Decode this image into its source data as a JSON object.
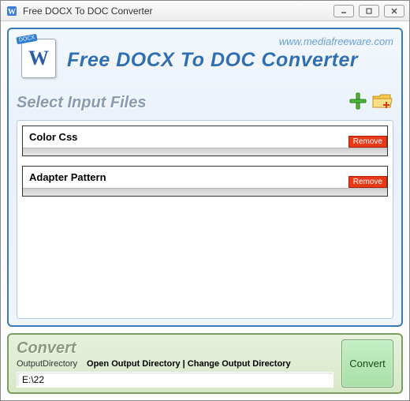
{
  "window": {
    "title": "Free DOCX To DOC Converter"
  },
  "header": {
    "url": "www.mediafreeware.com",
    "app_title": "Free DOCX To DOC Converter",
    "icon_badge": "DOCX",
    "icon_letter": "W"
  },
  "input_section": {
    "title": "Select Input Files",
    "files": [
      {
        "name": "Color Css",
        "remove_label": "Remove"
      },
      {
        "name": "Adapter Pattern",
        "remove_label": "Remove"
      }
    ]
  },
  "convert_section": {
    "title": "Convert",
    "output_label": "OutputDirectory",
    "open_link": "Open Output Directory",
    "separator": " | ",
    "change_link": "Change Output Directory",
    "directory_value": "E:\\22",
    "button_label": "Convert"
  }
}
